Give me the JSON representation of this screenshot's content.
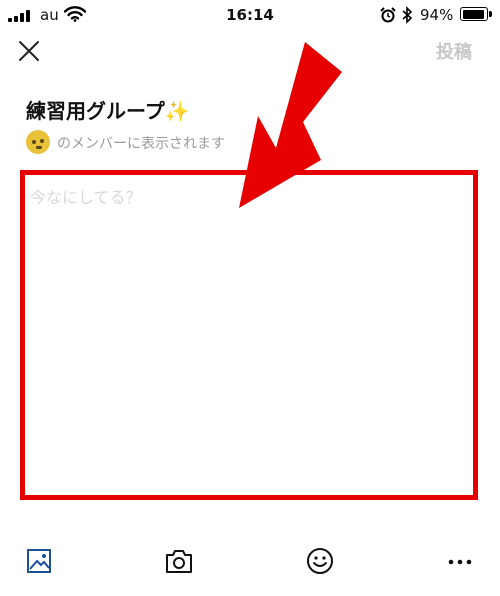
{
  "status_bar": {
    "carrier": "au",
    "time": "16:14",
    "battery_percent_text": "94%",
    "battery_level": 0.94,
    "icons": [
      "signal-icon",
      "wifi-icon",
      "alarm-icon",
      "bluetooth-icon",
      "battery-icon"
    ]
  },
  "header": {
    "close_icon": "close-icon",
    "post_label": "投稿"
  },
  "group": {
    "name": "練習用グループ✨",
    "visibility_text": "のメンバーに表示されます"
  },
  "composer": {
    "placeholder": "今なにしてる？",
    "value": ""
  },
  "toolbar": {
    "icons": [
      "image-icon",
      "camera-icon",
      "smiley-icon",
      "more-icon"
    ]
  },
  "colors": {
    "highlight": "#e60000",
    "post_disabled": "#c8c8c8",
    "avatar": "#e8c33a",
    "toolbar_image_icon": "#1d4f9c"
  }
}
